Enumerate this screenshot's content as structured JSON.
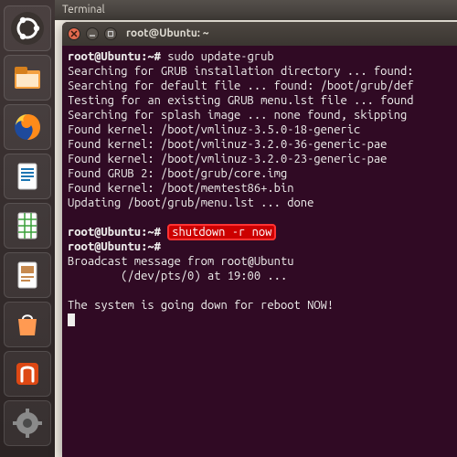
{
  "menubar": {
    "title": "Terminal"
  },
  "window": {
    "title": "root@Ubuntu: ~"
  },
  "launcher": {
    "items": [
      {
        "name": "dash",
        "accent": "#ffffff"
      },
      {
        "name": "files",
        "accent": "#e9850f"
      },
      {
        "name": "firefox",
        "accent": "#e66000"
      },
      {
        "name": "writer",
        "accent": "#1b74b2"
      },
      {
        "name": "calc",
        "accent": "#3aa03a"
      },
      {
        "name": "impress",
        "accent": "#c6894e"
      },
      {
        "name": "software-center",
        "accent": "#ff8b3a"
      },
      {
        "name": "ubuntu-one",
        "accent": "#dd4814"
      },
      {
        "name": "settings",
        "accent": "#8a8a8a"
      }
    ]
  },
  "terminal": {
    "prompt": "root@Ubuntu:~#",
    "lines": [
      {
        "prompt": true,
        "cmd": "sudo update-grub"
      },
      {
        "text": "Searching for GRUB installation directory ... found:"
      },
      {
        "text": "Searching for default file ... found: /boot/grub/def"
      },
      {
        "text": "Testing for an existing GRUB menu.lst file ... found"
      },
      {
        "text": "Searching for splash image ... none found, skipping "
      },
      {
        "text": "Found kernel: /boot/vmlinuz-3.5.0-18-generic"
      },
      {
        "text": "Found kernel: /boot/vmlinuz-3.2.0-36-generic-pae"
      },
      {
        "text": "Found kernel: /boot/vmlinuz-3.2.0-23-generic-pae"
      },
      {
        "text": "Found GRUB 2: /boot/grub/core.img"
      },
      {
        "text": "Found kernel: /boot/memtest86+.bin"
      },
      {
        "text": "Updating /boot/grub/menu.lst ... done"
      },
      {
        "text": ""
      },
      {
        "prompt": true,
        "cmd": "shutdown -r now",
        "highlight": true
      },
      {
        "prompt": true,
        "cmd": ""
      },
      {
        "text": "Broadcast message from root@Ubuntu"
      },
      {
        "text": "        (/dev/pts/0) at 19:00 ..."
      },
      {
        "text": ""
      },
      {
        "text": "The system is going down for reboot NOW!"
      }
    ]
  }
}
